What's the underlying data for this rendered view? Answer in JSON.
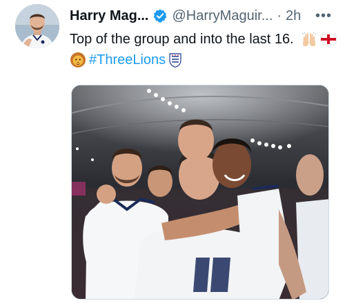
{
  "tweet": {
    "display_name": "Harry Mag...",
    "handle": "@HarryMaguir...",
    "separator": "·",
    "timestamp": "2h",
    "more_label": "•••",
    "text_line1": "Top of the group and into the last 16.",
    "hashtag": "#ThreeLions",
    "emojis": [
      "raising-hands-emoji",
      "england-flag-emoji",
      "lion-emoji",
      "three-lions-crest-emoji"
    ],
    "verified_color": "#1d9bf0",
    "link_color": "#1d9bf0",
    "media_description_icon": "photo-england-players-celebrating"
  }
}
